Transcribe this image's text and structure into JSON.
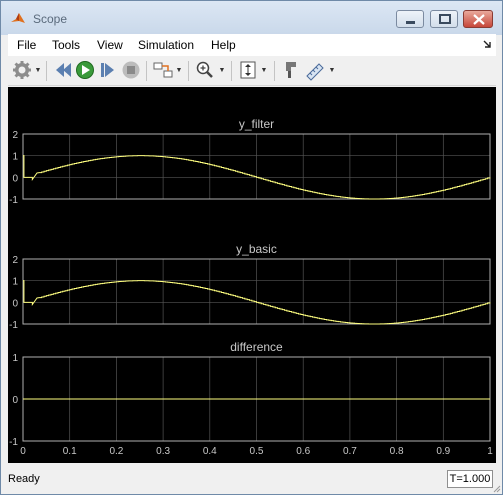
{
  "window": {
    "title": "Scope",
    "icon": "matlab-icon"
  },
  "menu": {
    "items": [
      "File",
      "Tools",
      "View",
      "Simulation",
      "Help"
    ],
    "overflow_icon": "dock-arrow-icon"
  },
  "toolbar": {
    "icons": [
      "gear-icon",
      "step-back-icon",
      "run-icon",
      "step-forward-icon",
      "stop-icon",
      "signal-selector-icon",
      "zoom-in-icon",
      "scale-axes-icon",
      "style-icon",
      "cursor-measure-icon"
    ]
  },
  "colors": {
    "plot_bg": "#000000",
    "axes_bg": "#000000",
    "grid": "#555555",
    "axis": "#b0b0b0",
    "text": "#c8c8c8",
    "trace": "#ffff80"
  },
  "chart_data": [
    {
      "type": "line",
      "title": "y_filter",
      "xlim": [
        0,
        1
      ],
      "ylim": [
        -1,
        2
      ],
      "xticks": [],
      "yticks": [
        "-1",
        "0",
        "1",
        "2"
      ],
      "grid": true,
      "series": [
        {
          "x": [
            0,
            0.002,
            0.002,
            0.02,
            0.02,
            0.03,
            0.03,
            1
          ],
          "y": [
            1,
            1,
            0,
            0,
            -0.1,
            -0.1,
            0.2,
            "sin(2*pi*t)"
          ]
        }
      ]
    },
    {
      "type": "line",
      "title": "y_basic",
      "xlim": [
        0,
        1
      ],
      "ylim": [
        -1,
        2
      ],
      "xticks": [],
      "yticks": [
        "-1",
        "0",
        "1",
        "2"
      ],
      "grid": true,
      "series": [
        {
          "x": [
            0,
            0.002,
            0.002,
            0.02,
            0.02,
            0.03,
            0.03,
            1
          ],
          "y": [
            1,
            1,
            0,
            0,
            -0.1,
            -0.1,
            0.2,
            "sin(2*pi*t)"
          ]
        }
      ]
    },
    {
      "type": "line",
      "title": "difference",
      "xlim": [
        0,
        1
      ],
      "ylim": [
        -1,
        1
      ],
      "xticks": [
        "0",
        "0.1",
        "0.2",
        "0.3",
        "0.4",
        "0.5",
        "0.6",
        "0.7",
        "0.8",
        "0.9",
        "1"
      ],
      "yticks": [
        "-1",
        "0",
        "1"
      ],
      "grid": true,
      "series": [
        {
          "x": [
            0,
            1
          ],
          "y": [
            0,
            0
          ]
        }
      ]
    }
  ],
  "status": {
    "text": "Ready",
    "time": "T=1.000"
  }
}
